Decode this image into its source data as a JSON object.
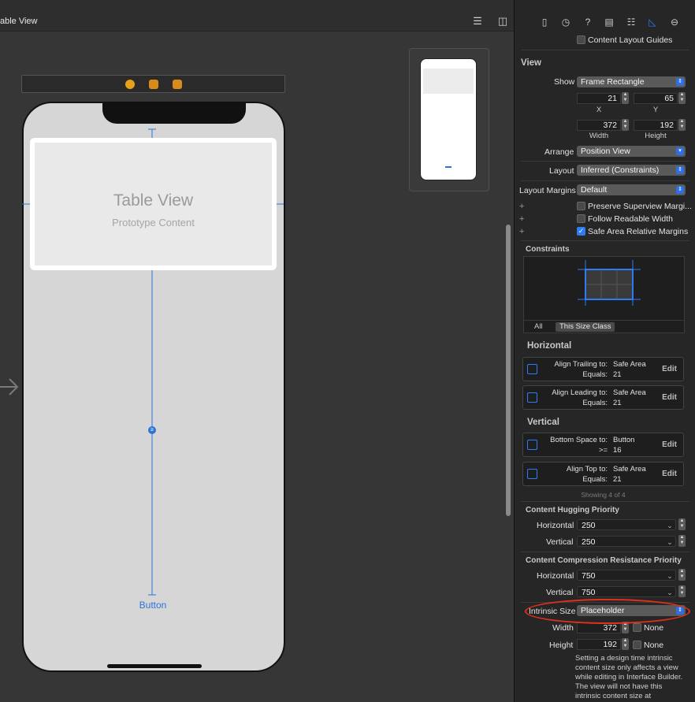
{
  "canvas": {
    "title": "able View",
    "table_view": {
      "title": "Table View",
      "subtitle": "Prototype Content"
    },
    "button_label": "Button",
    "constraint_badge": "≥"
  },
  "inspector": {
    "content_layout_guides": "Content Layout Guides",
    "view_header": "View",
    "show": {
      "label": "Show",
      "value": "Frame Rectangle"
    },
    "x": {
      "value": "21",
      "label": "X"
    },
    "y": {
      "value": "65",
      "label": "Y"
    },
    "width": {
      "value": "372",
      "label": "Width"
    },
    "height": {
      "value": "192",
      "label": "Height"
    },
    "arrange": {
      "label": "Arrange",
      "value": "Position View"
    },
    "layout": {
      "label": "Layout",
      "value": "Inferred (Constraints)"
    },
    "layout_margins": {
      "label": "Layout Margins",
      "value": "Default"
    },
    "checks": [
      {
        "label": "Preserve Superview Margi...",
        "checked": false
      },
      {
        "label": "Follow Readable Width",
        "checked": false
      },
      {
        "label": "Safe Area Relative Margins",
        "checked": true
      }
    ],
    "constraints_header": "Constraints",
    "constraints_tabs": [
      "All",
      "This Size Class"
    ],
    "horizontal_header": "Horizontal",
    "vertical_header": "Vertical",
    "horizontal_constraints": [
      {
        "line1_label": "Align Trailing to:",
        "line1_value": "Safe Area",
        "line2_label": "Equals:",
        "line2_value": "21",
        "edit": "Edit"
      },
      {
        "line1_label": "Align Leading to:",
        "line1_value": "Safe Area",
        "line2_label": "Equals:",
        "line2_value": "21",
        "edit": "Edit"
      }
    ],
    "vertical_constraints": [
      {
        "line1_label": "Bottom Space to:",
        "line1_value": "Button",
        "line2_label": ">=",
        "line2_value": "16",
        "edit": "Edit"
      },
      {
        "line1_label": "Align Top to:",
        "line1_value": "Safe Area",
        "line2_label": "Equals:",
        "line2_value": "21",
        "edit": "Edit"
      }
    ],
    "showing": "Showing 4 of 4",
    "hugging": {
      "header": "Content Hugging Priority",
      "horizontal_label": "Horizontal",
      "horizontal_value": "250",
      "vertical_label": "Vertical",
      "vertical_value": "250"
    },
    "compression": {
      "header": "Content Compression Resistance Priority",
      "horizontal_label": "Horizontal",
      "horizontal_value": "750",
      "vertical_label": "Vertical",
      "vertical_value": "750"
    },
    "intrinsic": {
      "label": "Intrinsic Size",
      "value": "Placeholder",
      "width_label": "Width",
      "width_value": "372",
      "height_label": "Height",
      "height_value": "192",
      "none_label": "None"
    },
    "help_text": "Setting a design time intrinsic content size only affects a view while editing in Interface Builder. The view will not have this intrinsic content size at"
  },
  "colors": {
    "accent": "#2f7bf5",
    "highlight": "#e0301e",
    "constraint": "#2e74d6"
  }
}
